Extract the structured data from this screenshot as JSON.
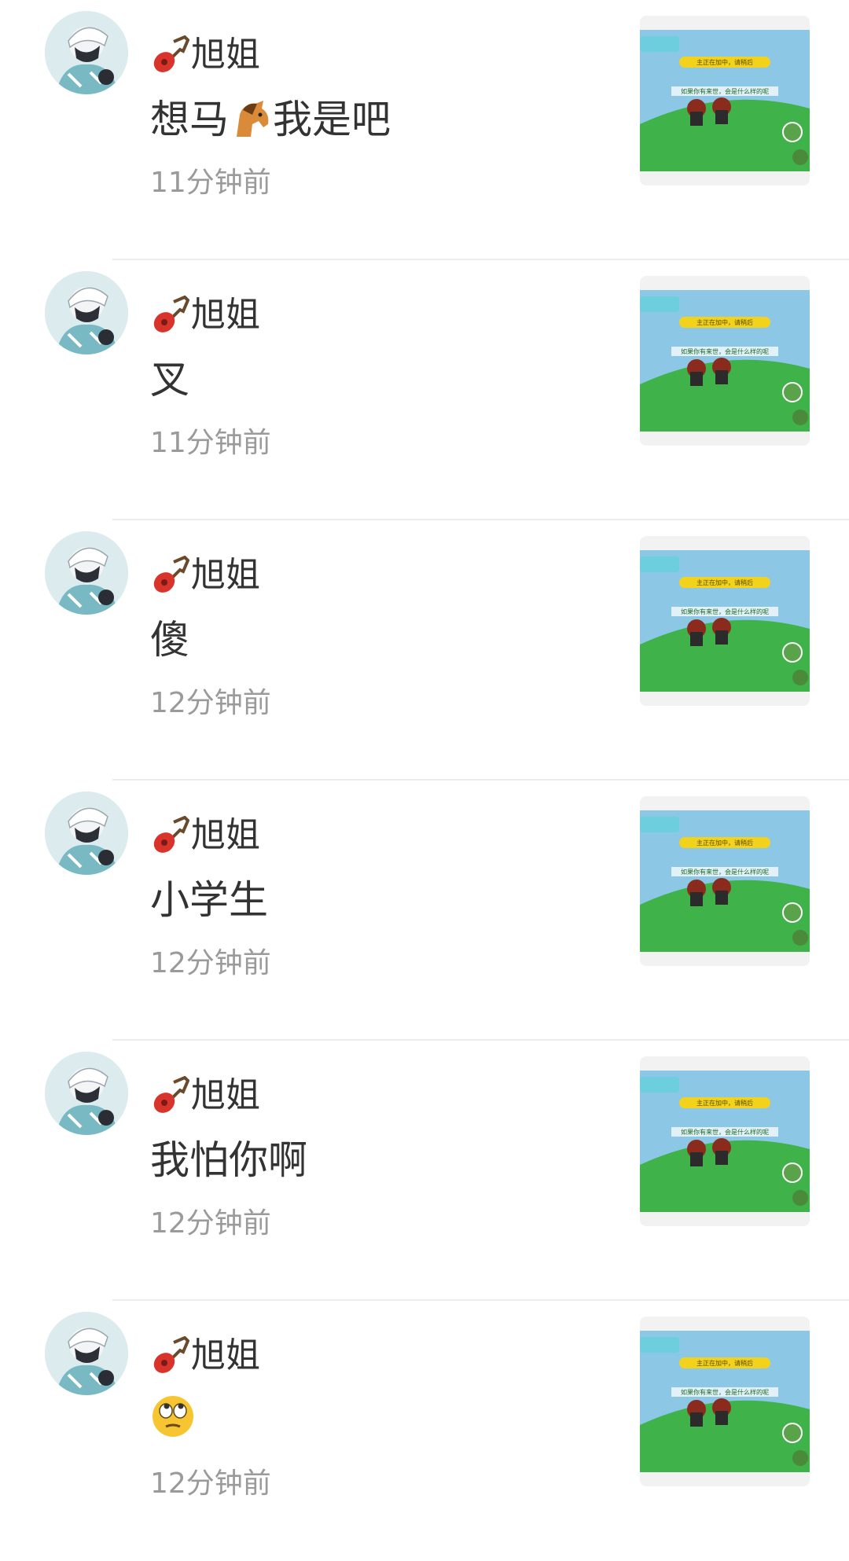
{
  "items": [
    {
      "name": "旭姐",
      "message": "想马",
      "message_emoji": "horse-emoji",
      "message_suffix": "我是吧",
      "time": "11分钟前"
    },
    {
      "name": "旭姐",
      "message": "叉",
      "message_emoji": "",
      "message_suffix": "",
      "time": "11分钟前"
    },
    {
      "name": "旭姐",
      "message": "傻",
      "message_emoji": "",
      "message_suffix": "",
      "time": "12分钟前"
    },
    {
      "name": "旭姐",
      "message": "小学生",
      "message_emoji": "",
      "message_suffix": "",
      "time": "12分钟前"
    },
    {
      "name": "旭姐",
      "message": "我怕你啊",
      "message_emoji": "",
      "message_suffix": "",
      "time": "12分钟前"
    },
    {
      "name": "旭姐",
      "message": "",
      "message_emoji": "face-with-rolling-eyes-emoji",
      "message_suffix": "",
      "time": "12分钟前"
    }
  ],
  "thumbnail": {
    "banner_text": "主正在加中，请稍后",
    "caption_text": "如果你有来世，会是什么样的呢",
    "colors": {
      "sky": "#8cc8e6",
      "grass": "#3fb24a",
      "banner": "#f2d21b"
    }
  },
  "colors": {
    "name": "#333333",
    "time": "#9a9a9a",
    "divider": "#ececec"
  }
}
